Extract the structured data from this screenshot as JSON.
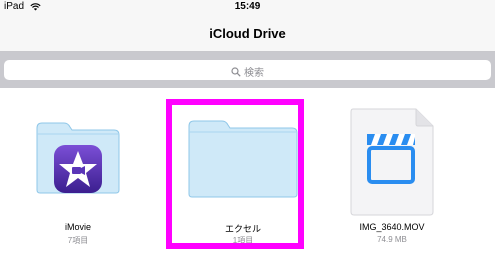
{
  "status_bar": {
    "device": "iPad",
    "time": "15:49"
  },
  "nav": {
    "title": "iCloud Drive"
  },
  "search": {
    "placeholder": "検索"
  },
  "items": [
    {
      "name": "iMovie",
      "meta": "7項目",
      "type": "folder-with-app-icon"
    },
    {
      "name": "エクセル",
      "meta": "1項目",
      "type": "folder"
    },
    {
      "name": "IMG_3640.MOV",
      "meta": "74.9 MB",
      "type": "video-file"
    }
  ],
  "colors": {
    "folder_fill": "#cfe9f8",
    "folder_stroke": "#8fc7e8",
    "highlight": "#ff00ff",
    "accent_blue": "#2a8df0"
  }
}
